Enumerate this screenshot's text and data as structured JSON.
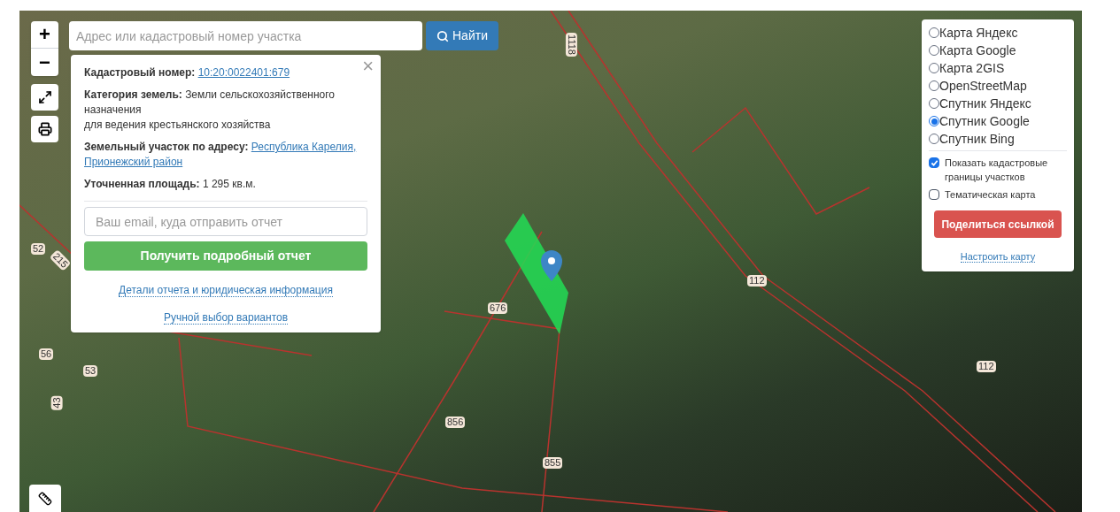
{
  "zoom": {
    "in": "+",
    "out": "−"
  },
  "search": {
    "placeholder": "Адрес или кадастровый номер участка",
    "button": "Найти"
  },
  "info_panel": {
    "close": "×",
    "fields": [
      {
        "label": "Кадастровый номер:",
        "kind": "link",
        "lines": [
          "10:20:0022401:679"
        ]
      },
      {
        "label": "Категория земель:",
        "kind": "text",
        "lines": [
          "Земли сельскохозяйственного назначения",
          "для ведения крестьянского хозяйства"
        ]
      },
      {
        "label": "Земельный участок по адресу:",
        "kind": "link",
        "lines": [
          "Республика Карелия,",
          "Прионежский район"
        ]
      },
      {
        "label": "Уточненная площадь:",
        "kind": "text",
        "lines": [
          "1 295 кв.м."
        ]
      }
    ],
    "email_placeholder": "Ваш email, куда отправить отчет",
    "report_button": "Получить подробный отчет",
    "links": [
      "Детали отчета и юридическая информация",
      "Ручной выбор вариантов"
    ]
  },
  "layers": [
    {
      "label": "Карта Яндекс",
      "selected": false
    },
    {
      "label": "Карта Google",
      "selected": false
    },
    {
      "label": "Карта 2GIS",
      "selected": false
    },
    {
      "label": "OpenStreetMap",
      "selected": false
    },
    {
      "label": "Спутник Яндекс",
      "selected": false
    },
    {
      "label": "Спутник Google",
      "selected": true
    },
    {
      "label": "Спутник Bing",
      "selected": false
    }
  ],
  "options": [
    {
      "label": "Показать кадастровые границы участков",
      "checked": true
    },
    {
      "label": "Тематическая карта",
      "checked": false
    }
  ],
  "share_button": "Поделиться ссылкой",
  "settings_link": "Настроить карту",
  "map_labels": [
    {
      "text": "1118"
    },
    {
      "text": "52"
    },
    {
      "text": "215"
    },
    {
      "text": "56"
    },
    {
      "text": "53"
    },
    {
      "text": "43"
    },
    {
      "text": "676"
    },
    {
      "text": "856"
    },
    {
      "text": "855"
    },
    {
      "text": "112"
    },
    {
      "text": "112"
    }
  ]
}
